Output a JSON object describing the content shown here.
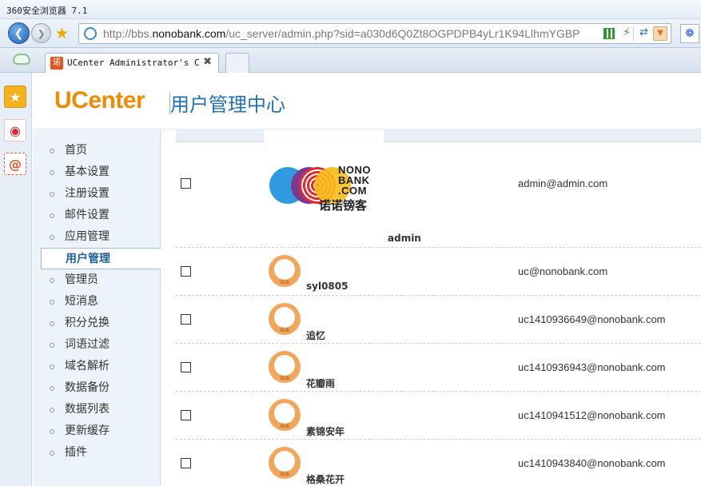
{
  "window": {
    "title": "360安全浏览器 7.1"
  },
  "navbar": {
    "url_prefix": "http://bbs.",
    "url_domain": "nonobank.com",
    "url_rest": "/uc_server/admin.php?sid=a030d6Q0Zt8OGPDPB4yLr1K94LlhmYGBP"
  },
  "tabs": [
    {
      "label": "UCenter Administrator's Cont",
      "favicon": "诺"
    }
  ],
  "header": {
    "logo": "UCenter",
    "subtitle": "用户管理中心"
  },
  "menu": {
    "items": [
      {
        "label": "首页"
      },
      {
        "label": "基本设置"
      },
      {
        "label": "注册设置"
      },
      {
        "label": "邮件设置"
      },
      {
        "label": "应用管理"
      },
      {
        "label": "用户管理",
        "active": true
      },
      {
        "label": "管理员"
      },
      {
        "label": "短消息"
      },
      {
        "label": "积分兑换"
      },
      {
        "label": "词语过滤"
      },
      {
        "label": "域名解析"
      },
      {
        "label": "数据备份"
      },
      {
        "label": "数据列表"
      },
      {
        "label": "更新缓存"
      },
      {
        "label": "插件"
      }
    ]
  },
  "logo_block": {
    "line1": "NONO",
    "line2": "BANK",
    "line3": ".COM",
    "cn": "诺诺镑客"
  },
  "avatar_caption": "诺诺",
  "users": [
    {
      "username": "admin",
      "email": "admin@admin.com"
    },
    {
      "username": "syl0805",
      "email": "uc@nonobank.com"
    },
    {
      "username": "追忆",
      "email": "uc1410936649@nonobank.com"
    },
    {
      "username": "花瓣雨",
      "email": "uc1410936943@nonobank.com"
    },
    {
      "username": "素锦安年",
      "email": "uc1410941512@nonobank.com"
    },
    {
      "username": "格桑花开",
      "email": "uc1410943840@nonobank.com"
    }
  ],
  "colors": {
    "accent": "#f08a00",
    "brand_blue": "#1f72b8",
    "menu_bg": "#edf3fa"
  }
}
